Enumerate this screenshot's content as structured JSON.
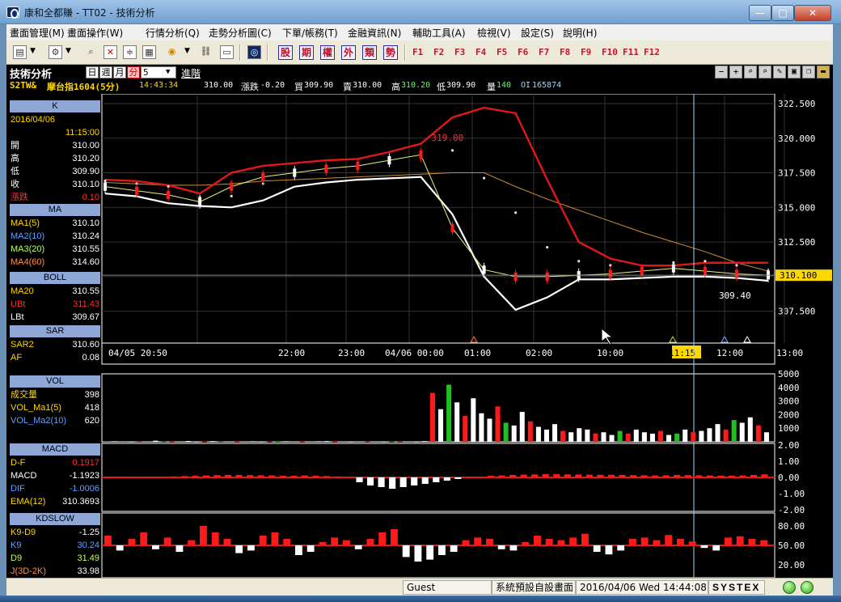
{
  "window": {
    "title": "康和全都賺 - TT02 - 技術分析",
    "min": "—",
    "max": "□",
    "close": "✕"
  },
  "menu": [
    "畫面管理(M)",
    "畫面操作(W)",
    "行情分析(Q)",
    "走勢分析圖(C)",
    "下單/帳務(T)",
    "金融資訊(N)",
    "輔助工具(A)",
    "檢視(V)",
    "設定(S)",
    "說明(H)"
  ],
  "toolbar": {
    "icons": [
      "chart-type-icon",
      "settings-icon",
      "zoom-icon",
      "cross-icon",
      "compare-icon",
      "grid-icon",
      "sound-icon",
      "link-icon",
      "screen-icon",
      "brand-icon"
    ],
    "categories": [
      "股",
      "期",
      "權",
      "外",
      "類",
      "勢"
    ],
    "fkeys": [
      "F1",
      "F2",
      "F3",
      "F4",
      "F5",
      "F6",
      "F7",
      "F8",
      "F9",
      "F10",
      "F11",
      "F12"
    ]
  },
  "header": {
    "title": "技術分析",
    "periods": [
      "日",
      "週",
      "月",
      "分"
    ],
    "active_period": "分",
    "interval": "5",
    "advanced": "進階",
    "symbol": "S2TW&",
    "name": "摩台指1604(5分)",
    "time": "14:43:34",
    "price": "310.00",
    "change_label": "漲跌",
    "change": "-0.20",
    "bid_label": "買",
    "bid": "309.90",
    "ask_label": "賣",
    "ask": "310.00",
    "high_label": "高",
    "high": "310.20",
    "low_label": "低",
    "low": "309.90",
    "vol_label": "量",
    "vol": "140",
    "oi_label": "OI",
    "oi": "165874"
  },
  "sidebar": {
    "k": {
      "title": "K",
      "date": "2016/04/06",
      "time": "11:15:00",
      "rows": [
        {
          "label": "開",
          "value": "310.00"
        },
        {
          "label": "高",
          "value": "310.20"
        },
        {
          "label": "低",
          "value": "309.90"
        },
        {
          "label": "收",
          "value": "310.10"
        },
        {
          "label": "漲跌",
          "value": "0.10"
        }
      ]
    },
    "ma": {
      "title": "MA",
      "rows": [
        {
          "label": "MA1(5)",
          "value": "310.10"
        },
        {
          "label": "MA2(10)",
          "value": "310.24"
        },
        {
          "label": "MA3(20)",
          "value": "310.55"
        },
        {
          "label": "MA4(60)",
          "value": "314.60"
        }
      ]
    },
    "boll": {
      "title": "BOLL",
      "rows": [
        {
          "label": "MA20",
          "value": "310.55"
        },
        {
          "label": "UBt",
          "value": "311.43"
        },
        {
          "label": "LBt",
          "value": "309.67"
        }
      ]
    },
    "sar": {
      "title": "SAR",
      "rows": [
        {
          "label": "SAR2",
          "value": "310.60"
        },
        {
          "label": "AF",
          "value": "0.08"
        }
      ]
    },
    "vol": {
      "title": "VOL",
      "rows": [
        {
          "label": "成交量",
          "value": "398"
        },
        {
          "label": "VOL_Ma1(5)",
          "value": "418"
        },
        {
          "label": "VOL_Ma2(10)",
          "value": "620"
        }
      ]
    },
    "macd": {
      "title": "MACD",
      "rows": [
        {
          "label": "D-F",
          "value": "0.1917"
        },
        {
          "label": "MACD",
          "value": "-1.1923"
        },
        {
          "label": "DIF",
          "value": "-1.0006"
        },
        {
          "label": "EMA(12)",
          "value": "310.3693"
        }
      ]
    },
    "kd": {
      "title": "KDSLOW",
      "rows": [
        {
          "label": "K9-D9",
          "value": "-1.25"
        },
        {
          "label": "K9",
          "value": "30.24"
        },
        {
          "label": "D9",
          "value": "31.49"
        },
        {
          "label": "J(3D-2K)",
          "value": "33.98"
        }
      ]
    }
  },
  "colors": {
    "up": "#ff1a1a",
    "down": "#ffffff",
    "bg": "#000000",
    "grid": "#3a3a3a",
    "yellow": "#ffd700",
    "cyan": "#9fd8ff"
  },
  "chart_data": [
    {
      "type": "line",
      "title": "K",
      "y_ticks": [
        "322.500",
        "320.000",
        "317.500",
        "315.000",
        "312.500",
        "310.000",
        "307.500"
      ],
      "y_values": [
        322.5,
        320,
        317.5,
        315,
        312.5,
        310,
        307.5
      ],
      "ylim": [
        305.2,
        323.2
      ],
      "x_ticks": [
        "04/05 20:50",
        "22:00",
        "23:00",
        "04/06 00:00",
        "01:00",
        "02:00",
        "10:00",
        "11:15",
        "12:00",
        "13:00"
      ],
      "price_tag": "310.100",
      "annotations": [
        {
          "text": "319.00"
        },
        {
          "text": "309.40"
        }
      ],
      "series": [
        {
          "name": "MA4(60)",
          "values": [
            316.8,
            316.7,
            316.6,
            316.6,
            316.7,
            316.9,
            317.0,
            317.1,
            317.2,
            317.3,
            317.4,
            317.5,
            317.5,
            316.5,
            315.6,
            314.8,
            314.0,
            313.2,
            312.5,
            311.8,
            311.0,
            310.4
          ]
        },
        {
          "name": "UBt",
          "values": [
            317.0,
            316.9,
            316.6,
            316.0,
            317.5,
            318.0,
            318.2,
            318.4,
            318.5,
            319.0,
            319.6,
            321.5,
            322.2,
            321.8,
            317.0,
            312.5,
            311.3,
            310.8,
            310.8,
            311.0,
            311.0,
            311.0
          ]
        },
        {
          "name": "LBt",
          "values": [
            316.0,
            315.8,
            315.3,
            315.1,
            315.0,
            315.5,
            316.5,
            316.8,
            317.0,
            317.1,
            317.2,
            314.5,
            310.0,
            307.6,
            308.5,
            309.8,
            309.8,
            309.9,
            310.0,
            310.0,
            309.9,
            309.7
          ]
        },
        {
          "name": "SAR2",
          "values": [
            316.8,
            316.6,
            316.4,
            315.6,
            315.7,
            316.6,
            317.2,
            317.6,
            317.8,
            318.2,
            318.8,
            319.0,
            317.0,
            314.5,
            312.0,
            311.0,
            310.7,
            310.5,
            310.9,
            311.0,
            310.7,
            310.3
          ]
        },
        {
          "name": "MA1(5)",
          "values": [
            316.5,
            316.2,
            315.9,
            315.4,
            316.5,
            317.2,
            317.5,
            317.8,
            318.0,
            318.4,
            318.8,
            313.5,
            310.5,
            310.0,
            310.0,
            310.1,
            310.2,
            310.4,
            310.6,
            310.4,
            310.2,
            310.1
          ]
        }
      ]
    },
    {
      "type": "bar",
      "title": "VOL",
      "y_ticks": [
        "5000",
        "4000",
        "3000",
        "2000",
        "1000"
      ],
      "y_values": [
        5000,
        4000,
        3000,
        2000,
        1000
      ],
      "ylim": [
        0,
        5000
      ],
      "values": [
        60,
        40,
        30,
        20,
        50,
        30,
        80,
        40,
        20,
        30,
        60,
        20,
        30,
        50,
        40,
        30,
        20,
        30,
        40,
        20,
        30,
        20,
        40,
        30,
        20,
        30,
        40,
        50,
        20,
        30,
        20,
        30,
        40,
        30,
        20,
        30,
        40,
        30,
        20,
        50,
        3600,
        2400,
        4200,
        2900,
        1900,
        3200,
        2100,
        1700,
        2600,
        1400,
        1200,
        2200,
        1500,
        1100,
        900,
        1300,
        800,
        700,
        1000,
        900,
        600,
        700,
        500,
        800,
        600,
        900,
        700,
        600,
        800,
        500,
        600,
        900,
        700,
        800,
        1000,
        1300,
        900,
        1600,
        1400,
        1800,
        1200,
        700
      ]
    },
    {
      "type": "bar",
      "title": "MACD",
      "y_ticks": [
        "2.00",
        "1.00",
        "0.00",
        "-1.00",
        "-2.00"
      ],
      "y_values": [
        2,
        1,
        0,
        -1,
        -2
      ],
      "ylim": [
        -2.1,
        2.1
      ],
      "values": [
        0.02,
        0.02,
        0.03,
        0.04,
        0.05,
        0.05,
        0.06,
        0.08,
        0.1,
        0.12,
        0.14,
        0.15,
        0.15,
        0.14,
        0.13,
        0.12,
        0.1,
        0.1,
        0.12,
        0.1,
        0.08,
        0.06,
        0.05,
        -0.3,
        -0.5,
        -0.6,
        -0.7,
        -0.6,
        -0.5,
        -0.4,
        -0.3,
        -0.2,
        -0.1,
        0.02,
        0.05,
        0.1,
        0.12,
        0.15,
        0.17,
        0.18,
        0.2,
        0.2,
        0.19,
        0.18,
        0.17,
        0.16,
        0.16,
        0.15,
        0.14,
        0.13,
        0.12,
        0.13,
        0.15,
        0.14,
        0.13,
        0.12,
        0.11,
        0.1,
        0.12,
        0.15,
        0.19
      ]
    },
    {
      "type": "bar",
      "title": "KDSLOW",
      "y_ticks": [
        "80.00",
        "50.00",
        "20.00"
      ],
      "y_values": [
        80,
        50,
        20
      ],
      "ylim": [
        0,
        100
      ],
      "values": [
        15,
        -8,
        10,
        20,
        -6,
        12,
        -10,
        8,
        30,
        20,
        10,
        -12,
        -8,
        15,
        20,
        10,
        -15,
        -10,
        5,
        12,
        8,
        -6,
        10,
        20,
        25,
        -18,
        -25,
        -22,
        -15,
        -10,
        8,
        12,
        10,
        -6,
        -8,
        5,
        15,
        10,
        8,
        12,
        18,
        -10,
        -14,
        -8,
        10,
        12,
        8,
        16,
        10,
        6,
        -4,
        -8,
        12,
        14,
        10,
        8
      ]
    }
  ]
}
